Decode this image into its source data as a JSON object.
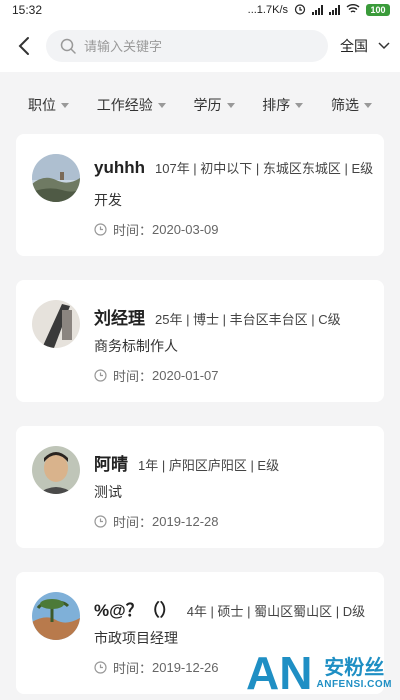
{
  "status_bar": {
    "time": "15:32",
    "network_speed": "...1.7K/s",
    "battery": "100"
  },
  "header": {
    "search_placeholder": "请输入关键字",
    "region": "全国"
  },
  "filters": [
    {
      "label": "职位"
    },
    {
      "label": "工作经验"
    },
    {
      "label": "学历"
    },
    {
      "label": "排序"
    },
    {
      "label": "筛选"
    }
  ],
  "cards": [
    {
      "name": "yuhhh",
      "meta": "107年 | 初中以下 | 东城区东城区 | E级",
      "title": "开发",
      "time_label": "时间：",
      "time": "2020-03-09"
    },
    {
      "name": "刘经理",
      "meta": "25年 | 博士 | 丰台区丰台区 | C级",
      "title": "商务标制作人",
      "time_label": "时间：",
      "time": "2020-01-07"
    },
    {
      "name": "阿晴",
      "meta": "1年 | 庐阳区庐阳区 | E级",
      "title": "测试",
      "time_label": "时间：",
      "time": "2019-12-28"
    },
    {
      "name": "%@？（）",
      "meta": "4年 | 硕士 | 蜀山区蜀山区 | D级",
      "title": "市政项目经理",
      "time_label": "时间：",
      "time": "2019-12-26"
    }
  ],
  "watermark": {
    "logo": "AN",
    "text": "安粉丝",
    "domain": "ANFENSI.COM"
  }
}
